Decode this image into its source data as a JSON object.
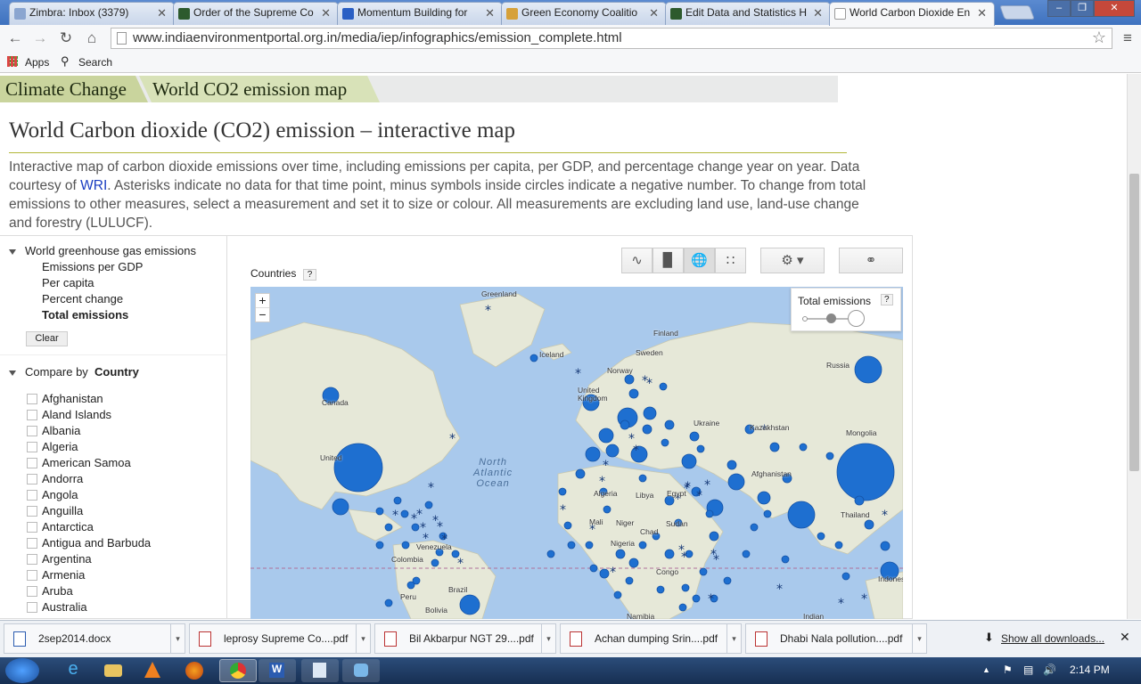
{
  "tabs": [
    {
      "label": "Zimbra: Inbox (3379)",
      "icon": "zimbra-icon",
      "color": "#8aa5d0"
    },
    {
      "label": "Order of the Supreme Co",
      "icon": "site-icon",
      "color": "#2d5a2d"
    },
    {
      "label": "Momentum Building for",
      "icon": "globe-icon",
      "color": "#2a5fc4"
    },
    {
      "label": "Green Economy Coalitio",
      "icon": "gec-icon",
      "color": "#d6a13a"
    },
    {
      "label": "Edit Data and Statistics H",
      "icon": "site-icon",
      "color": "#2d5a2d"
    },
    {
      "label": "World Carbon Dioxide En",
      "icon": "page-icon",
      "color": "#ffffff"
    }
  ],
  "address": "www.indiaenvironmentportal.org.in/media/iep/infographics/emission_complete.html",
  "bookmarks": {
    "apps": "Apps",
    "search": "Search"
  },
  "breadcrumb": {
    "first": "Climate Change",
    "second": "World CO2 emission map"
  },
  "page_title": "World Carbon dioxide (CO2) emission – interactive map",
  "description": {
    "part1": "Interactive map of carbon dioxide emissions over time, including emissions per capita, per GDP, and percentage change year on year. Data courtesy of ",
    "link": "WRI",
    "part2": ". Asterisks indicate no data for that time point, minus symbols inside circles indicate a negative number. To change from total emissions to other measures, select a measurement and set it to size or colour. All measurements are excluding land use, land-use change and forestry (LULUCF)."
  },
  "panel": {
    "group": "World greenhouse gas emissions",
    "measures": [
      "Emissions per GDP",
      "Per capita",
      "Percent change",
      "Total emissions"
    ],
    "clear": "Clear",
    "compare_label": "Compare by",
    "compare_value": "Country",
    "countries": [
      "Afghanistan",
      "Aland Islands",
      "Albania",
      "Algeria",
      "American Samoa",
      "Andorra",
      "Angola",
      "Anguilla",
      "Antarctica",
      "Antigua and Barbuda",
      "Argentina",
      "Armenia",
      "Aruba",
      "Australia"
    ]
  },
  "chart": {
    "countries_label": "Countries",
    "help": "?",
    "legend_title": "Total emissions",
    "zoom_in": "+",
    "zoom_out": "−",
    "map_labels": {
      "greenland": "Greenland",
      "iceland": "Iceland",
      "finland": "Finland",
      "sweden": "Sweden",
      "norway": "Norway",
      "russia": "Russia",
      "canada": "Canada",
      "united": "United",
      "united_kingdom": "United\nKingdom",
      "ukraine": "Ukraine",
      "kazakhstan": "Kazakhstan",
      "mongolia": "Mongolia",
      "afghanistan": "Afghanistan",
      "algeria": "Algeria",
      "libya": "Libya",
      "egypt": "Egypt",
      "sudan": "Sudan",
      "mali": "Mali",
      "niger": "Niger",
      "chad": "Chad",
      "nigeria": "Nigeria",
      "congo": "Congo",
      "namibia": "Namibia",
      "thailand": "Thailand",
      "indonesia": "Indonesi",
      "venezuela": "Venezuela",
      "colombia": "Colombia",
      "peru": "Peru",
      "brazil": "Brazil",
      "bolivia": "Bolivia",
      "ocean": "North\nAtlantic\nOcean",
      "indian": "Indian"
    }
  },
  "downloads": [
    {
      "name": "2sep2014.docx",
      "type": "docx"
    },
    {
      "name": "leprosy Supreme Co....pdf",
      "type": "pdf"
    },
    {
      "name": "Bil Akbarpur NGT 29....pdf",
      "type": "pdf"
    },
    {
      "name": "Achan dumping Srin....pdf",
      "type": "pdf"
    },
    {
      "name": "Dhabi Nala pollution....pdf",
      "type": "pdf"
    }
  ],
  "show_all": "Show all downloads...",
  "clock": "2:14 PM"
}
